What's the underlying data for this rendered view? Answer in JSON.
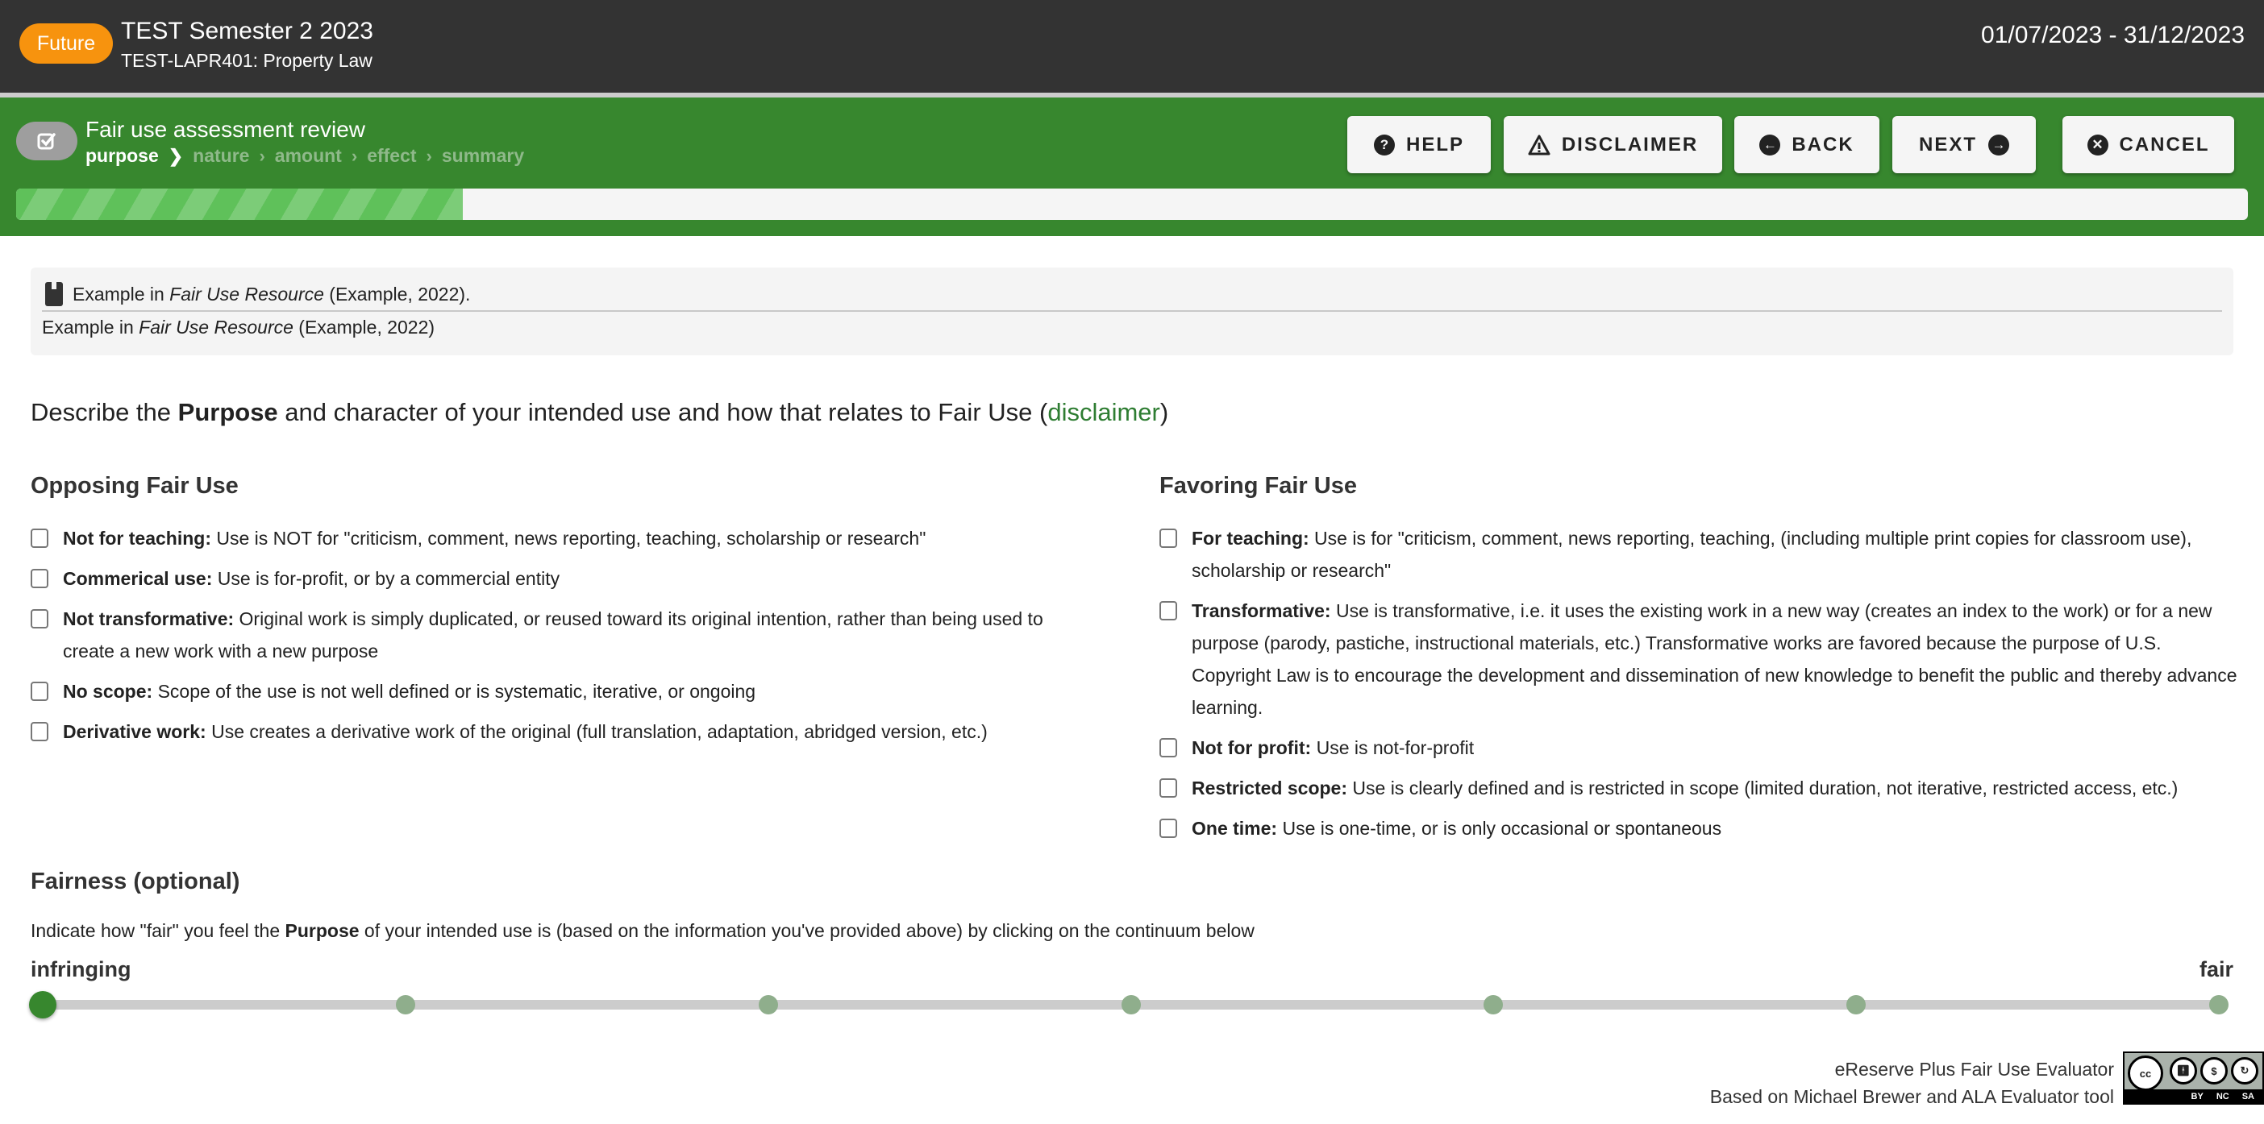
{
  "header": {
    "status_badge": "Future",
    "semester": "TEST Semester 2 2023",
    "course": "TEST-LAPR401: Property Law",
    "dates": "01/07/2023 - 31/12/2023"
  },
  "assessment": {
    "icon": "checkbox-check-icon",
    "title": "Fair use assessment review",
    "steps": [
      {
        "label": "purpose",
        "active": true
      },
      {
        "label": "nature",
        "active": false
      },
      {
        "label": "amount",
        "active": false
      },
      {
        "label": "effect",
        "active": false
      },
      {
        "label": "summary",
        "active": false
      }
    ],
    "progress_percent": 20,
    "buttons": {
      "help": {
        "label": "HELP",
        "icon": "question-circle-icon"
      },
      "disclaimer": {
        "label": "DISCLAIMER",
        "icon": "warning-triangle-icon"
      },
      "back": {
        "label": "BACK",
        "icon": "arrow-left-circle-icon"
      },
      "next": {
        "label": "NEXT",
        "icon": "arrow-right-circle-icon"
      },
      "cancel": {
        "label": "CANCEL",
        "icon": "close-circle-icon"
      }
    }
  },
  "citation": {
    "icon": "book-icon",
    "line1_prefix": "Example in ",
    "line1_title": "Fair Use Resource",
    "line1_suffix": " (Example, 2022).",
    "line2_prefix": "Example in ",
    "line2_title": "Fair Use Resource",
    "line2_suffix": " (Example, 2022)"
  },
  "prompt": {
    "before": "Describe the ",
    "bold": "Purpose",
    "after": " and character of your intended use and how that relates to Fair Use (",
    "link": "disclaimer",
    "close": ")"
  },
  "opposing": {
    "heading": "Opposing Fair Use",
    "items": [
      {
        "term": "Not for teaching:",
        "desc": " Use is NOT for \"criticism, comment, news reporting, teaching, scholarship or research\"",
        "checked": false
      },
      {
        "term": "Commerical use:",
        "desc": " Use is for-profit, or by a commercial entity",
        "checked": false
      },
      {
        "term": "Not transformative:",
        "desc": " Original work is simply duplicated, or reused toward its original intention, rather than being used to create a new work with a new purpose",
        "checked": false
      },
      {
        "term": "No scope:",
        "desc": " Scope of the use is not well defined or is systematic, iterative, or ongoing",
        "checked": false
      },
      {
        "term": "Derivative work:",
        "desc": " Use creates a derivative work of the original (full translation, adaptation, abridged version, etc.)",
        "checked": false
      }
    ]
  },
  "favoring": {
    "heading": "Favoring Fair Use",
    "items": [
      {
        "term": "For teaching:",
        "desc": " Use is for \"criticism, comment, news reporting, teaching, (including multiple print copies for classroom use), scholarship or research\"",
        "checked": false
      },
      {
        "term": "Transformative:",
        "desc": " Use is transformative, i.e. it uses the existing work in a new way (creates an index to the work) or for a new purpose (parody, pastiche, instructional materials, etc.) Transformative works are favored because the purpose of U.S. Copyright Law is to encourage the development and dissemination of new knowledge to benefit the public and thereby advance learning.",
        "checked": false
      },
      {
        "term": "Not for profit:",
        "desc": " Use is not-for-profit",
        "checked": false
      },
      {
        "term": "Restricted scope:",
        "desc": " Use is clearly defined and is restricted in scope (limited duration, not iterative, restricted access, etc.)",
        "checked": false
      },
      {
        "term": "One time:",
        "desc": " Use is one-time, or is only occasional or spontaneous",
        "checked": false
      }
    ]
  },
  "fairness": {
    "heading": "Fairness (optional)",
    "desc_before": "Indicate how \"fair\" you feel the ",
    "desc_bold": "Purpose",
    "desc_after": " of your intended use is (based on the information you've provided above) by clicking on the continuum below",
    "left_label": "infringing",
    "right_label": "fair",
    "steps": 7,
    "selected_index": 0
  },
  "footer": {
    "line1": "eReserve Plus Fair Use Evaluator",
    "line2": "Based on Michael Brewer and ALA Evaluator tool",
    "license_badge": "cc-by-nc-sa-icon",
    "license_labels": [
      "BY",
      "NC",
      "SA"
    ]
  },
  "colors": {
    "header_bg": "#333333",
    "badge": "#f7930e",
    "green": "#37872e",
    "progress": "#5fc15a",
    "link": "#2e7d32",
    "step_dot": "#8fae8c"
  }
}
